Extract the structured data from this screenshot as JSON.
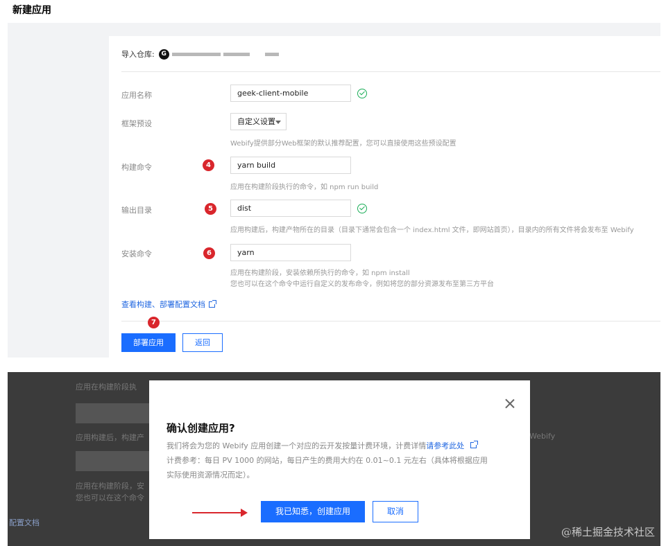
{
  "page": {
    "title": "新建应用"
  },
  "form": {
    "repo_label": "导入仓库:",
    "repo_icon": "G",
    "fields": {
      "app_name": {
        "label": "应用名称",
        "value": "geek-client-mobile"
      },
      "framework": {
        "label": "框架预设",
        "value": "自定义设置",
        "help": "Webify提供部分Web框架的默认推荐配置，您可以直接使用这些预设配置"
      },
      "build": {
        "label": "构建命令",
        "value": "yarn build",
        "help": "应用在构建阶段执行的命令，如 npm run build",
        "badge": "4"
      },
      "output": {
        "label": "输出目录",
        "value": "dist",
        "help": "应用构建后，构建产物所在的目录（目录下通常会包含一个 index.html 文件，即网站首页），目录内的所有文件将会发布至 Webify",
        "badge": "5"
      },
      "install": {
        "label": "安装命令",
        "value": "yarn",
        "help1": "应用在构建阶段，安装依赖所执行的命令，如 npm install",
        "help2": "您也可以在这个命令中运行自定义的发布命令，例如将您的部分资源发布至第三方平台",
        "badge": "6"
      }
    },
    "doc_link": "查看构建、部署配置文档",
    "step_badge": "7",
    "deploy_button": "部署应用",
    "back_button": "返回"
  },
  "background": {
    "line1": "应用在构建阶段执",
    "line2": "应用构建后，构建产",
    "line3": "应用在构建阶段，安",
    "line4": "您也可以在这个命令",
    "right_text": "Webify",
    "doc_link": "配置文档"
  },
  "modal": {
    "title": "确认创建应用?",
    "body_prefix": "我们将会为您的 Webify 应用创建一个对应的云开发按量计费环境，计费详情",
    "body_link": "请参考此处",
    "body_line2": "计费参考：每日 PV 1000 的网站，每日产生的费用大约在 0.01~0.1 元左右（具体将根据应用",
    "body_line3": "实际使用资源情况而定）。",
    "confirm_button": "我已知悉，创建应用",
    "cancel_button": "取消"
  },
  "watermark": "@稀土掘金技术社区",
  "colors": {
    "primary": "#1a6dff",
    "badge": "#d9262c",
    "success": "#1aad57",
    "link": "#1f66e0"
  }
}
